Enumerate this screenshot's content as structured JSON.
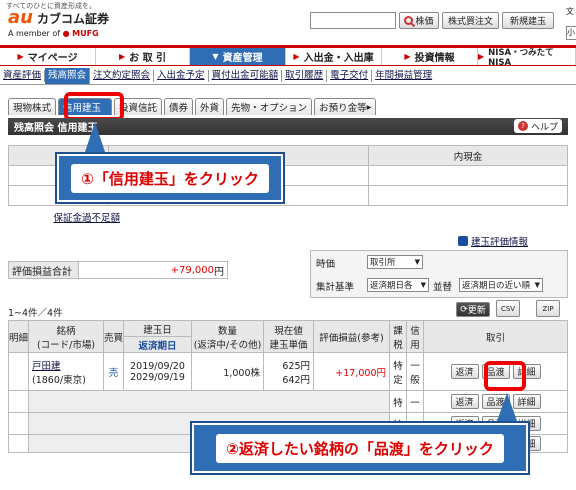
{
  "header": {
    "tagline": "すべてのひとに資産形成を。",
    "logo_au": "au",
    "logo_text": "カブコム証券",
    "member_prefix": "A member of",
    "member_mufg": "MUFG",
    "search_button": "株価",
    "order_button": "株式買注文",
    "new_position_button": "新規建玉",
    "partial_text": "文",
    "partial_field": "小"
  },
  "main_nav": [
    {
      "label": "マイページ",
      "active": false
    },
    {
      "label": "お 取 引",
      "active": false
    },
    {
      "label": "資産管理",
      "active": true
    },
    {
      "label": "入出金・入出庫",
      "active": false
    },
    {
      "label": "投資情報",
      "active": false
    },
    {
      "label": "NISA・つみたてNISA",
      "active": false
    }
  ],
  "sub_nav": [
    {
      "label": "資産評価",
      "active": false
    },
    {
      "label": "残高照会",
      "active": true
    },
    {
      "label": "注文約定照会",
      "active": false
    },
    {
      "label": "入出金予定",
      "active": false
    },
    {
      "label": "買付出金可能額",
      "active": false
    },
    {
      "label": "取引履歴",
      "active": false
    },
    {
      "label": "電子交付",
      "active": false
    },
    {
      "label": "年間損益管理",
      "active": false
    }
  ],
  "tabs": [
    {
      "label": "現物株式"
    },
    {
      "label": "信用建玉"
    },
    {
      "label": "投資信託"
    },
    {
      "label": "債券"
    },
    {
      "label": "外貨"
    },
    {
      "label": "先物・オプション"
    },
    {
      "label": "お預り金等"
    }
  ],
  "section": {
    "title": "残高照会 信用建玉",
    "help_label": "ヘルプ",
    "help_icon_char": "?"
  },
  "upper_table": {
    "col_header": "内現金",
    "link": "保証金過不足額"
  },
  "callout1": "①「信用建玉」をクリック",
  "callout2": "②返済したい銘柄の「品渡」をクリック",
  "valuation_link": "建玉評価情報",
  "summary": {
    "label": "評価損益合計",
    "value": "+79,000",
    "unit": "円"
  },
  "filters": {
    "period_label": "時価",
    "period_value": "取引所",
    "group_label": "集計基準",
    "group_value": "返済期日各",
    "sort_label": "並替",
    "sort_value": "返済期日の近い順"
  },
  "count_text": "1~4件／4件",
  "toolbar": {
    "refresh": "更新",
    "csv": "CSV",
    "zip": "ZIP"
  },
  "table": {
    "headers": {
      "detail": "明細",
      "name": "銘柄",
      "name_sub": "(コード/市場)",
      "side": "売買",
      "date": "建玉日",
      "due": "返済期日",
      "qty": "数量",
      "qty_sub": "(返済中/その他)",
      "price": "現在値",
      "price_sub": "建玉単価",
      "pl": "評価損益(参考)",
      "tax": "課税",
      "credit": "信用",
      "action": "取引"
    },
    "rows": [
      {
        "name": "戸田建",
        "code": "(1860/東京)",
        "side": "売",
        "date": "2019/09/20",
        "due": "2029/09/19",
        "qty": "1,000株",
        "price": "625円",
        "unit_price": "642円",
        "pl": "+17,000円",
        "tax": "特定",
        "credit": "一般"
      },
      {
        "tax": "特",
        "credit": "一"
      },
      {
        "tax": "特",
        "credit": "一"
      },
      {
        "tax": "特",
        "credit": "一"
      }
    ],
    "buttons": {
      "return": "返済",
      "delivery": "品渡",
      "detail": "詳細"
    }
  }
}
